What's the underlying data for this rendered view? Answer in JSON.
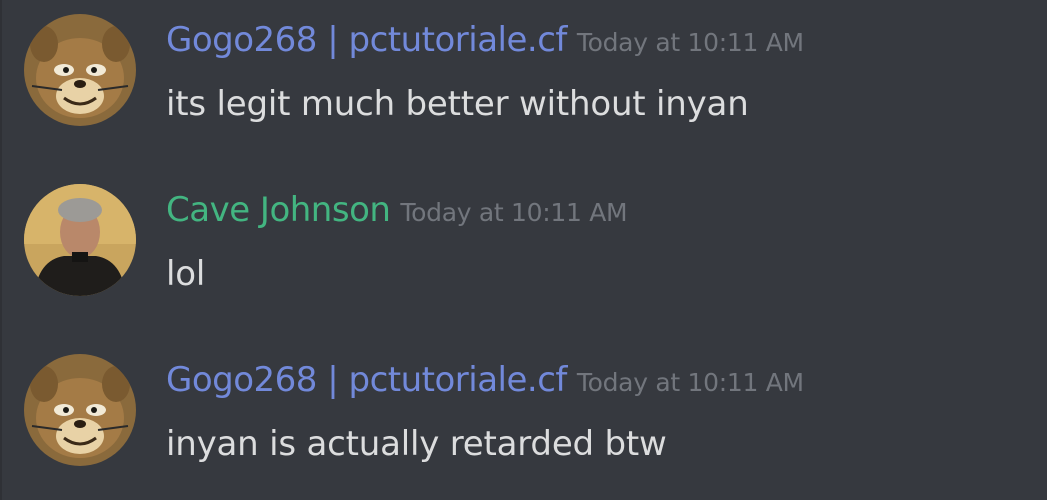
{
  "colors": {
    "background": "#36393f",
    "username_blue": "#7289da",
    "username_green": "#43b581",
    "timestamp": "#72767d",
    "message_text": "#dcddde"
  },
  "messages": [
    {
      "username": "Gogo268 | pctutoriale.cf",
      "username_color": "#7289da",
      "timestamp": "Today at 10:11 AM",
      "content": "its legit much better without inyan",
      "avatar": "cartoon-cat-avatar"
    },
    {
      "username": "Cave Johnson",
      "username_color": "#43b581",
      "timestamp": "Today at 10:11 AM",
      "content": "lol",
      "avatar": "photo-man-avatar"
    },
    {
      "username": "Gogo268 | pctutoriale.cf",
      "username_color": "#7289da",
      "timestamp": "Today at 10:11 AM",
      "content": "inyan is actually retarded btw",
      "avatar": "cartoon-cat-avatar"
    }
  ]
}
